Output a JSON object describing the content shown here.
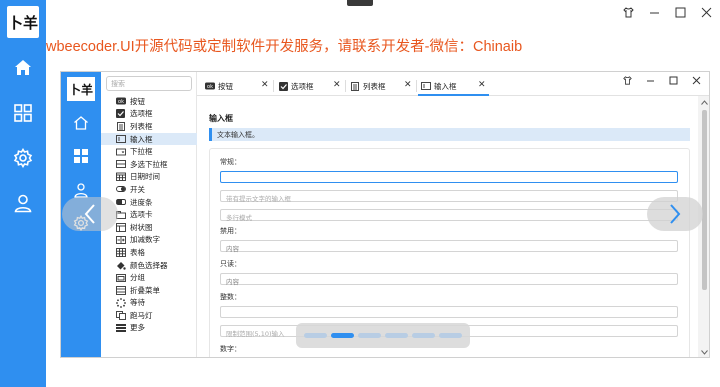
{
  "outer": {
    "logo_text": "卜羊",
    "banner": "wbeecoder.UI开源代码或定制软件开发服务，请联系开发者-微信：Chinaib",
    "nav_icons": [
      "home-icon",
      "apps-icon",
      "gear-icon",
      "user-icon"
    ],
    "window_controls": [
      "shirt-icon",
      "minimize-icon",
      "maximize-icon",
      "close-icon"
    ]
  },
  "inner": {
    "logo_text": "卜羊",
    "nav_icons": [
      "home-icon",
      "apps-icon",
      "user-icon",
      "gear-icon"
    ],
    "search_placeholder": "搜索",
    "menu": [
      {
        "label": "按钮",
        "icon": "button-icon"
      },
      {
        "label": "选项框",
        "icon": "checkbox-icon"
      },
      {
        "label": "列表框",
        "icon": "listbox-icon"
      },
      {
        "label": "输入框",
        "icon": "input-icon",
        "active": true
      },
      {
        "label": "下拉框",
        "icon": "dropdown-icon"
      },
      {
        "label": "多选下拉框",
        "icon": "multi-dropdown-icon"
      },
      {
        "label": "日期时间",
        "icon": "calendar-icon"
      },
      {
        "label": "开关",
        "icon": "toggle-icon"
      },
      {
        "label": "进度条",
        "icon": "progress-icon"
      },
      {
        "label": "选项卡",
        "icon": "tabs-icon"
      },
      {
        "label": "树状图",
        "icon": "tree-icon"
      },
      {
        "label": "加减数字",
        "icon": "stepper-icon"
      },
      {
        "label": "表格",
        "icon": "table-icon"
      },
      {
        "label": "颜色选择器",
        "icon": "palette-icon"
      },
      {
        "label": "分组",
        "icon": "group-icon"
      },
      {
        "label": "折叠菜单",
        "icon": "accordion-icon"
      },
      {
        "label": "等待",
        "icon": "spinner-icon"
      },
      {
        "label": "跑马灯",
        "icon": "marquee-icon"
      },
      {
        "label": "更多",
        "icon": "more-icon"
      }
    ],
    "tabs": [
      {
        "label": "按钮",
        "icon": "button-icon"
      },
      {
        "label": "选项框",
        "icon": "checkbox-icon"
      },
      {
        "label": "列表框",
        "icon": "listbox-icon"
      },
      {
        "label": "输入框",
        "icon": "input-icon",
        "active": true
      }
    ],
    "window_controls": [
      "shirt-icon",
      "minimize-icon",
      "maximize-icon",
      "close-icon"
    ],
    "content": {
      "title": "输入框",
      "description": "文本输入框。",
      "fields": {
        "normal_label": "常规：",
        "normal_value": "",
        "hint_placeholder": "带有提示文字的输入框",
        "multiline_placeholder": "多行模式",
        "disabled_label": "禁用：",
        "disabled_value": "内容",
        "readonly_label": "只读：",
        "readonly_value": "内容",
        "integer_label": "整数：",
        "integer_value": "",
        "range_placeholder": "限制范围(5,10)输入",
        "number_label": "数字："
      }
    }
  },
  "carousel": {
    "dot_count": 6,
    "active_dot": 1
  },
  "colors": {
    "accent": "#2f8ff0",
    "banner": "#e8571f",
    "selection": "#dbe9f8"
  }
}
